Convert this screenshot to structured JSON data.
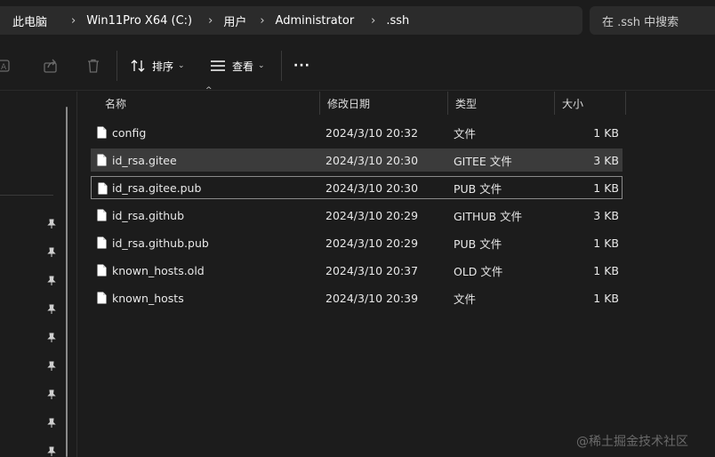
{
  "breadcrumb": [
    "此电脑",
    "Win11Pro X64 (C:)",
    "用户",
    "Administrator",
    ".ssh"
  ],
  "search": {
    "placeholder": "在 .ssh 中搜索"
  },
  "toolbar": {
    "sort_label": "排序",
    "view_label": "查看",
    "more_label": "···"
  },
  "columns": {
    "name": "名称",
    "date": "修改日期",
    "type": "类型",
    "size": "大小"
  },
  "files": [
    {
      "name": "config",
      "date": "2024/3/10 20:32",
      "type": "文件",
      "size": "1 KB"
    },
    {
      "name": "id_rsa.gitee",
      "date": "2024/3/10 20:30",
      "type": "GITEE 文件",
      "size": "3 KB"
    },
    {
      "name": "id_rsa.gitee.pub",
      "date": "2024/3/10 20:30",
      "type": "PUB 文件",
      "size": "1 KB"
    },
    {
      "name": "id_rsa.github",
      "date": "2024/3/10 20:29",
      "type": "GITHUB 文件",
      "size": "3 KB"
    },
    {
      "name": "id_rsa.github.pub",
      "date": "2024/3/10 20:29",
      "type": "PUB 文件",
      "size": "1 KB"
    },
    {
      "name": "known_hosts.old",
      "date": "2024/3/10 20:37",
      "type": "OLD 文件",
      "size": "1 KB"
    },
    {
      "name": "known_hosts",
      "date": "2024/3/10 20:39",
      "type": "文件",
      "size": "1 KB"
    }
  ],
  "watermark": "@稀土掘金技术社区"
}
